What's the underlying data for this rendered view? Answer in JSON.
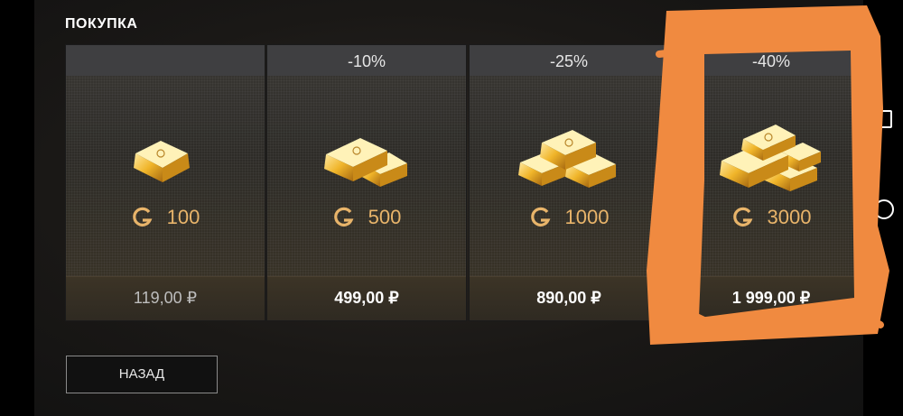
{
  "header": {
    "title": "ПОКУПКА"
  },
  "offers": [
    {
      "discount": "",
      "amount": "100",
      "price": "119,00 ₽",
      "tier": "small"
    },
    {
      "discount": "-10%",
      "amount": "500",
      "price": "499,00 ₽",
      "tier": "medium"
    },
    {
      "discount": "-25%",
      "amount": "1000",
      "price": "890,00 ₽",
      "tier": "large"
    },
    {
      "discount": "-40%",
      "amount": "3000",
      "price": "1 999,00 ₽",
      "tier": "xlarge"
    }
  ],
  "footer": {
    "back_label": "НАЗАД"
  },
  "colors": {
    "gold": "#e8b46a",
    "annotation": "#f08a40"
  },
  "icons": {
    "currency": "gold-currency-icon",
    "back": "nav-back-icon",
    "home": "nav-home-icon"
  }
}
